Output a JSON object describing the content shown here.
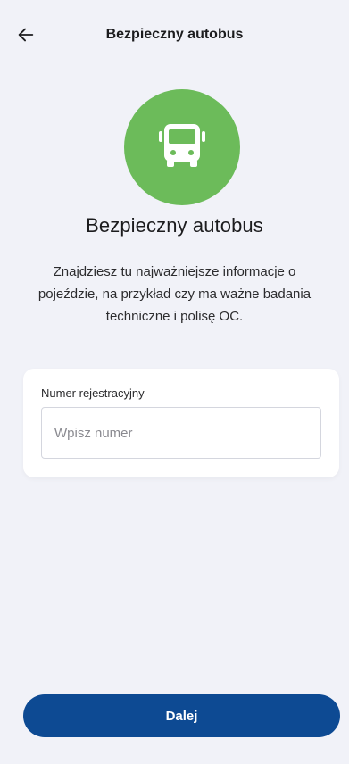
{
  "header": {
    "back_icon": "arrow-left-icon",
    "title": "Bezpieczny autobus"
  },
  "hero": {
    "icon": "bus-icon",
    "circle_color": "#6cbb5a",
    "title": "Bezpieczny autobus",
    "description": "Znajdziesz tu najważniejsze informacje o pojeździe, na przykład czy ma ważne badania techniczne i polisę OC."
  },
  "form": {
    "field_label": "Numer rejestracyjny",
    "field_value": "",
    "field_placeholder": "Wpisz numer"
  },
  "footer": {
    "primary_button_label": "Dalej",
    "primary_button_color": "#0d4a93"
  }
}
